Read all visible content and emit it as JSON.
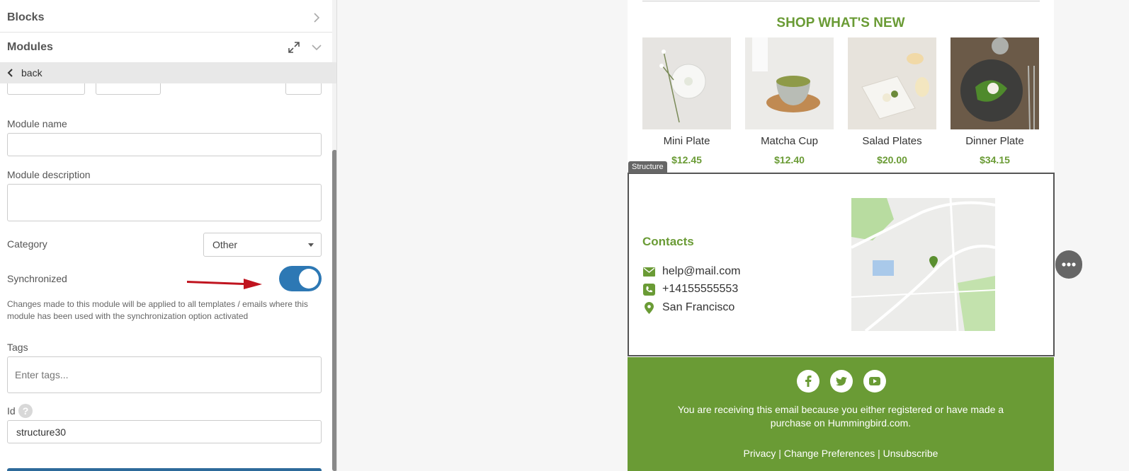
{
  "sidebar": {
    "blocks_label": "Blocks",
    "modules_label": "Modules",
    "back_label": "back",
    "module_name_label": "Module name",
    "module_name_value": "",
    "module_description_label": "Module description",
    "module_description_value": "",
    "category_label": "Category",
    "category_value": "Other",
    "synchronized_label": "Synchronized",
    "synchronized_on": true,
    "sync_hint": "Changes made to this module will be applied to all templates / emails where this module has been used with the synchronization option activated",
    "tags_label": "Tags",
    "tags_placeholder": "Enter tags...",
    "id_label": "Id",
    "id_help": "?",
    "id_value": "structure30"
  },
  "email": {
    "shop_title": "SHOP WHAT'S NEW",
    "products": [
      {
        "name": "Mini Plate",
        "price": "$12.45"
      },
      {
        "name": "Matcha Cup",
        "price": "$12.40"
      },
      {
        "name": "Salad Plates",
        "price": "$20.00"
      },
      {
        "name": "Dinner Plate",
        "price": "$34.15"
      }
    ],
    "structure_tag": "Structure",
    "contacts_title": "Contacts",
    "contacts": {
      "email": "help@mail.com",
      "phone": "+14155555553",
      "city": "San Francisco"
    },
    "footer_text": "You are receiving this email because you either registered or have made a purchase on Hummingbird.com.",
    "footer_links": "Privacy | Change Preferences | Unsubscribe"
  },
  "colors": {
    "brand_green": "#6a9b35",
    "toggle_blue": "#2d78b4",
    "annotation_red": "#c0141f"
  }
}
